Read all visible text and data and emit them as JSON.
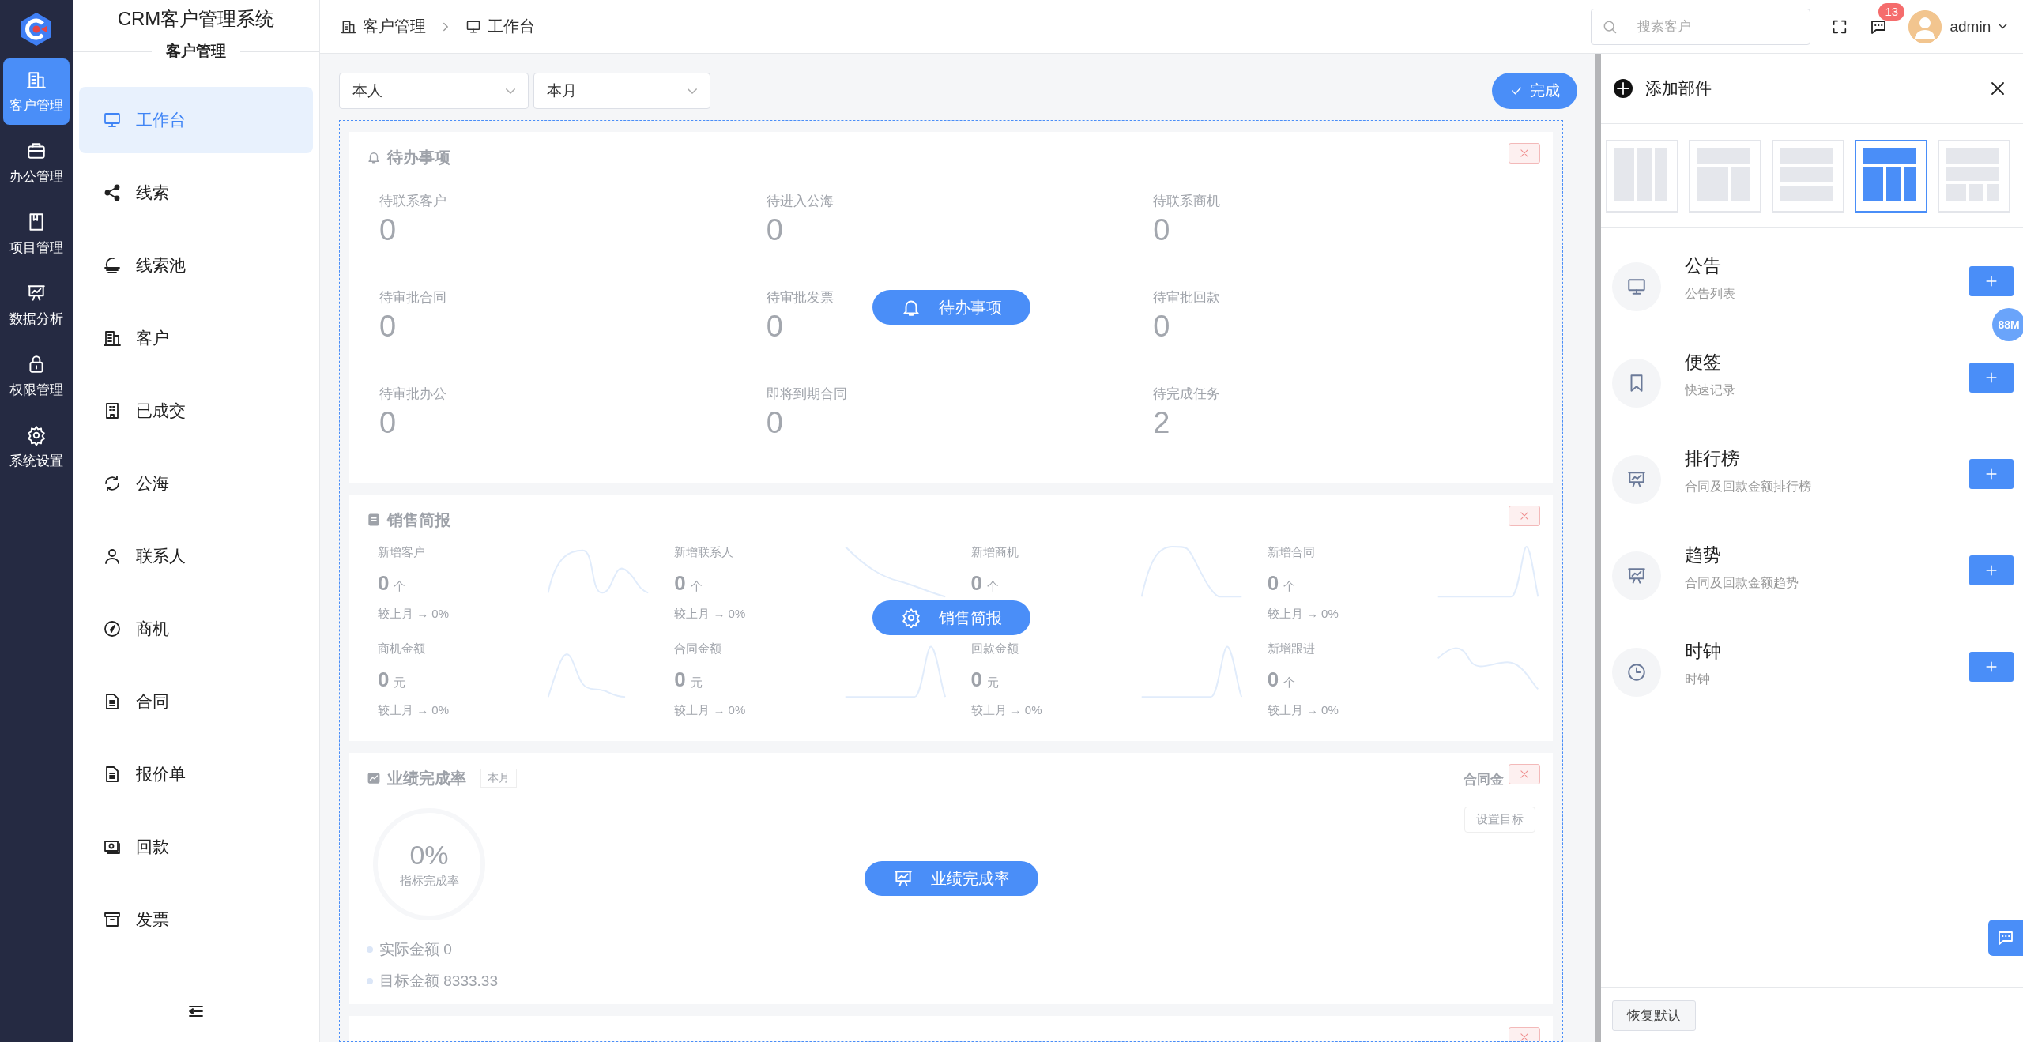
{
  "rail": {
    "items": [
      {
        "label": "客户管理",
        "selected": true
      },
      {
        "label": "办公管理",
        "selected": false
      },
      {
        "label": "项目管理",
        "selected": false
      },
      {
        "label": "数据分析",
        "selected": false
      },
      {
        "label": "权限管理",
        "selected": false
      },
      {
        "label": "系统设置",
        "selected": false
      }
    ]
  },
  "sidebar": {
    "app_title": "CRM客户管理系统",
    "section_title": "客户管理",
    "items": [
      {
        "label": "工作台",
        "selected": true
      },
      {
        "label": "线索",
        "selected": false
      },
      {
        "label": "线索池",
        "selected": false
      },
      {
        "label": "客户",
        "selected": false
      },
      {
        "label": "已成交",
        "selected": false
      },
      {
        "label": "公海",
        "selected": false
      },
      {
        "label": "联系人",
        "selected": false
      },
      {
        "label": "商机",
        "selected": false
      },
      {
        "label": "合同",
        "selected": false
      },
      {
        "label": "报价单",
        "selected": false
      },
      {
        "label": "回款",
        "selected": false
      },
      {
        "label": "发票",
        "selected": false
      }
    ]
  },
  "header": {
    "breadcrumb": [
      "客户管理",
      "工作台"
    ],
    "search": {
      "placeholder": "搜索客户"
    },
    "message_badge": "13",
    "user": "admin"
  },
  "toolbar": {
    "filters": [
      "本人",
      "本月"
    ],
    "done_button": "完成"
  },
  "widgets": [
    {
      "kind": "todo",
      "title": "待办事项",
      "overlay_label": "待办事项",
      "items": [
        {
          "label": "待联系客户",
          "value": "0"
        },
        {
          "label": "待进入公海",
          "value": "0"
        },
        {
          "label": "待联系商机",
          "value": "0"
        },
        {
          "label": "待审批合同",
          "value": "0"
        },
        {
          "label": "待审批发票",
          "value": "0"
        },
        {
          "label": "待审批回款",
          "value": "0"
        },
        {
          "label": "待审批办公",
          "value": "0"
        },
        {
          "label": "即将到期合同",
          "value": "0"
        },
        {
          "label": "待完成任务",
          "value": "2"
        }
      ]
    },
    {
      "kind": "sales",
      "title": "销售简报",
      "overlay_label": "销售简报",
      "metrics": [
        {
          "label": "新增客户",
          "value": "0",
          "unit": "个",
          "compare": "较上月 → 0%"
        },
        {
          "label": "新增联系人",
          "value": "0",
          "unit": "个",
          "compare": "较上月 → 0%"
        },
        {
          "label": "新增商机",
          "value": "0",
          "unit": "个"
        },
        {
          "label": "新增合同",
          "value": "0",
          "unit": "个",
          "compare": "较上月 → 0%"
        },
        {
          "label": "商机金额",
          "value": "0",
          "unit": "元",
          "compare": "较上月 → 0%"
        },
        {
          "label": "合同金额",
          "value": "0",
          "unit": "元",
          "compare": "较上月 → 0%"
        },
        {
          "label": "回款金额",
          "value": "0",
          "unit": "元",
          "compare": "较上月 → 0%"
        },
        {
          "label": "新增跟进",
          "value": "0",
          "unit": "个",
          "compare": "较上月 → 0%"
        }
      ]
    },
    {
      "kind": "performance",
      "title": "业绩完成率",
      "tag": "本月",
      "side_label": "合同金",
      "target_button": "设置目标",
      "percent": "0%",
      "percent_caption": "指标完成率",
      "legend": [
        "实际金额 0",
        "目标金额 8333.33"
      ],
      "overlay_label": "业绩完成率"
    },
    {
      "kind": "cut"
    }
  ],
  "panel": {
    "title": "添加部件",
    "layouts": [
      {
        "kind": "cols3",
        "selected": false
      },
      {
        "kind": "top2",
        "selected": false
      },
      {
        "kind": "rows3",
        "selected": false
      },
      {
        "kind": "top3",
        "selected": true
      },
      {
        "kind": "grid",
        "selected": false
      }
    ],
    "widgets": [
      {
        "title": "公告",
        "subtitle": "公告列表"
      },
      {
        "title": "便签",
        "subtitle": "快速记录"
      },
      {
        "title": "排行榜",
        "subtitle": "合同及回款金额排行榜"
      },
      {
        "title": "趋势",
        "subtitle": "合同及回款金额趋势"
      },
      {
        "title": "时钟",
        "subtitle": "时钟"
      }
    ],
    "restore_button": "恢复默认"
  },
  "memory_badge": "88M"
}
